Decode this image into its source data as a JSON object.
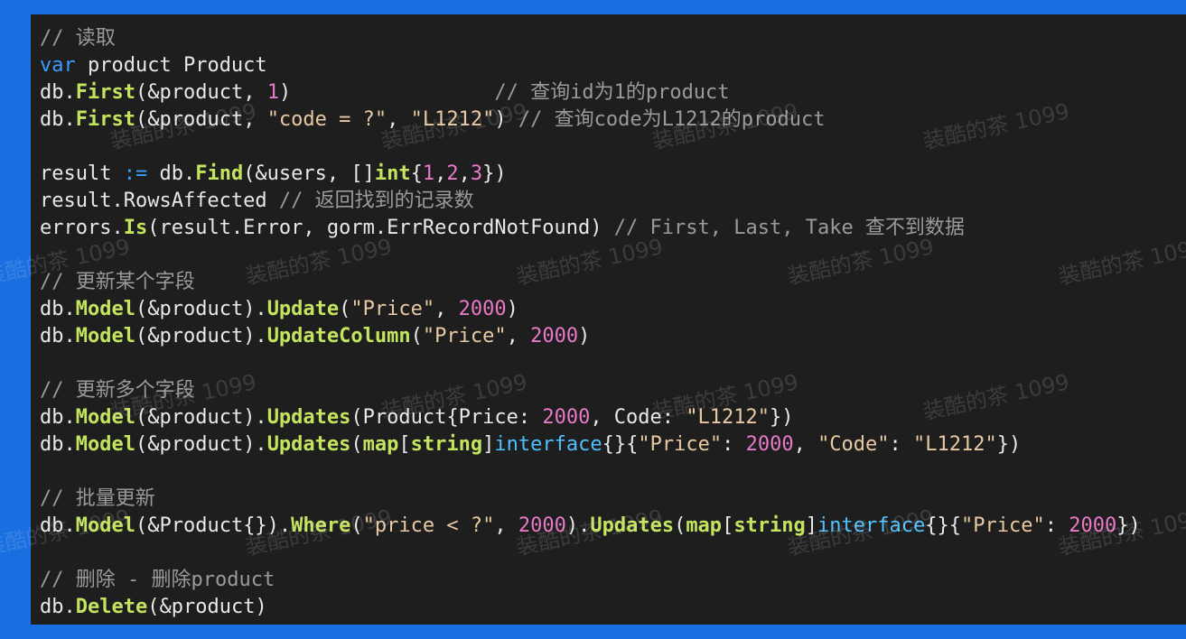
{
  "code": {
    "lines": [
      [
        {
          "t": "// 读取",
          "c": "cm"
        }
      ],
      [
        {
          "t": "var",
          "c": "kw"
        },
        {
          "t": " product Product",
          "c": "pl"
        }
      ],
      [
        {
          "t": "db.",
          "c": "pl"
        },
        {
          "t": "First",
          "c": "fn"
        },
        {
          "t": "(&product, ",
          "c": "pl"
        },
        {
          "t": "1",
          "c": "num"
        },
        {
          "t": ")                 ",
          "c": "pl"
        },
        {
          "t": "// 查询id为1的product",
          "c": "cm"
        }
      ],
      [
        {
          "t": "db.",
          "c": "pl"
        },
        {
          "t": "First",
          "c": "fn"
        },
        {
          "t": "(&product, ",
          "c": "pl"
        },
        {
          "t": "\"code = ?\"",
          "c": "str"
        },
        {
          "t": ", ",
          "c": "pl"
        },
        {
          "t": "\"L1212\"",
          "c": "str"
        },
        {
          "t": ") ",
          "c": "pl"
        },
        {
          "t": "// 查询code为L1212的product",
          "c": "cm"
        }
      ],
      [],
      [
        {
          "t": "result ",
          "c": "pl"
        },
        {
          "t": ":=",
          "c": "op"
        },
        {
          "t": " db.",
          "c": "pl"
        },
        {
          "t": "Find",
          "c": "fn"
        },
        {
          "t": "(&users, []",
          "c": "pl"
        },
        {
          "t": "int",
          "c": "bkw"
        },
        {
          "t": "{",
          "c": "pl"
        },
        {
          "t": "1",
          "c": "num"
        },
        {
          "t": ",",
          "c": "pl"
        },
        {
          "t": "2",
          "c": "num"
        },
        {
          "t": ",",
          "c": "pl"
        },
        {
          "t": "3",
          "c": "num"
        },
        {
          "t": "})",
          "c": "pl"
        }
      ],
      [
        {
          "t": "result.RowsAffected ",
          "c": "pl"
        },
        {
          "t": "// 返回找到的记录数",
          "c": "cm"
        }
      ],
      [
        {
          "t": "errors.",
          "c": "pl"
        },
        {
          "t": "Is",
          "c": "fn"
        },
        {
          "t": "(result.Error, gorm.ErrRecordNotFound) ",
          "c": "pl"
        },
        {
          "t": "// First, Last, Take 查不到数据",
          "c": "cm"
        }
      ],
      [],
      [
        {
          "t": "// 更新某个字段",
          "c": "cm"
        }
      ],
      [
        {
          "t": "db.",
          "c": "pl"
        },
        {
          "t": "Model",
          "c": "fn"
        },
        {
          "t": "(&product).",
          "c": "pl"
        },
        {
          "t": "Update",
          "c": "fn"
        },
        {
          "t": "(",
          "c": "pl"
        },
        {
          "t": "\"Price\"",
          "c": "str"
        },
        {
          "t": ", ",
          "c": "pl"
        },
        {
          "t": "2000",
          "c": "num"
        },
        {
          "t": ")",
          "c": "pl"
        }
      ],
      [
        {
          "t": "db.",
          "c": "pl"
        },
        {
          "t": "Model",
          "c": "fn"
        },
        {
          "t": "(&product).",
          "c": "pl"
        },
        {
          "t": "UpdateColumn",
          "c": "fn"
        },
        {
          "t": "(",
          "c": "pl"
        },
        {
          "t": "\"Price\"",
          "c": "str"
        },
        {
          "t": ", ",
          "c": "pl"
        },
        {
          "t": "2000",
          "c": "num"
        },
        {
          "t": ")",
          "c": "pl"
        }
      ],
      [],
      [
        {
          "t": "// 更新多个字段",
          "c": "cm"
        }
      ],
      [
        {
          "t": "db.",
          "c": "pl"
        },
        {
          "t": "Model",
          "c": "fn"
        },
        {
          "t": "(&product).",
          "c": "pl"
        },
        {
          "t": "Updates",
          "c": "fn"
        },
        {
          "t": "(Product{Price: ",
          "c": "pl"
        },
        {
          "t": "2000",
          "c": "num"
        },
        {
          "t": ", Code: ",
          "c": "pl"
        },
        {
          "t": "\"L1212\"",
          "c": "str"
        },
        {
          "t": "})",
          "c": "pl"
        }
      ],
      [
        {
          "t": "db.",
          "c": "pl"
        },
        {
          "t": "Model",
          "c": "fn"
        },
        {
          "t": "(&product).",
          "c": "pl"
        },
        {
          "t": "Updates",
          "c": "fn"
        },
        {
          "t": "(",
          "c": "pl"
        },
        {
          "t": "map",
          "c": "bkw"
        },
        {
          "t": "[",
          "c": "pl"
        },
        {
          "t": "string",
          "c": "bkw"
        },
        {
          "t": "]",
          "c": "pl"
        },
        {
          "t": "interface",
          "c": "cy"
        },
        {
          "t": "{}{",
          "c": "pl"
        },
        {
          "t": "\"Price\"",
          "c": "str"
        },
        {
          "t": ": ",
          "c": "pl"
        },
        {
          "t": "2000",
          "c": "num"
        },
        {
          "t": ", ",
          "c": "pl"
        },
        {
          "t": "\"Code\"",
          "c": "str"
        },
        {
          "t": ": ",
          "c": "pl"
        },
        {
          "t": "\"L1212\"",
          "c": "str"
        },
        {
          "t": "})",
          "c": "pl"
        }
      ],
      [],
      [
        {
          "t": "// 批量更新",
          "c": "cm"
        }
      ],
      [
        {
          "t": "db.",
          "c": "pl"
        },
        {
          "t": "Model",
          "c": "fn"
        },
        {
          "t": "(&Product{}).",
          "c": "pl"
        },
        {
          "t": "Where",
          "c": "fn"
        },
        {
          "t": "(",
          "c": "pl"
        },
        {
          "t": "\"price < ?\"",
          "c": "str"
        },
        {
          "t": ", ",
          "c": "pl"
        },
        {
          "t": "2000",
          "c": "num"
        },
        {
          "t": ").",
          "c": "pl"
        },
        {
          "t": "Updates",
          "c": "fn"
        },
        {
          "t": "(",
          "c": "pl"
        },
        {
          "t": "map",
          "c": "bkw"
        },
        {
          "t": "[",
          "c": "pl"
        },
        {
          "t": "string",
          "c": "bkw"
        },
        {
          "t": "]",
          "c": "pl"
        },
        {
          "t": "interface",
          "c": "cy"
        },
        {
          "t": "{}{",
          "c": "pl"
        },
        {
          "t": "\"Price\"",
          "c": "str"
        },
        {
          "t": ": ",
          "c": "pl"
        },
        {
          "t": "2000",
          "c": "num"
        },
        {
          "t": "})",
          "c": "pl"
        }
      ],
      [],
      [
        {
          "t": "// 删除 - 删除product",
          "c": "cm"
        }
      ],
      [
        {
          "t": "db.",
          "c": "pl"
        },
        {
          "t": "Delete",
          "c": "fn"
        },
        {
          "t": "(&product)",
          "c": "pl"
        }
      ]
    ]
  },
  "watermark": {
    "text": "装酷的茶 1099"
  },
  "colors": {
    "frame": "#1a6fe0",
    "panel": "#1e1e1e",
    "keyword": "#3b9cff",
    "function": "#c3e45f",
    "string": "#e8c9a2",
    "number": "#e879c8",
    "comment": "#9a9a9a"
  }
}
